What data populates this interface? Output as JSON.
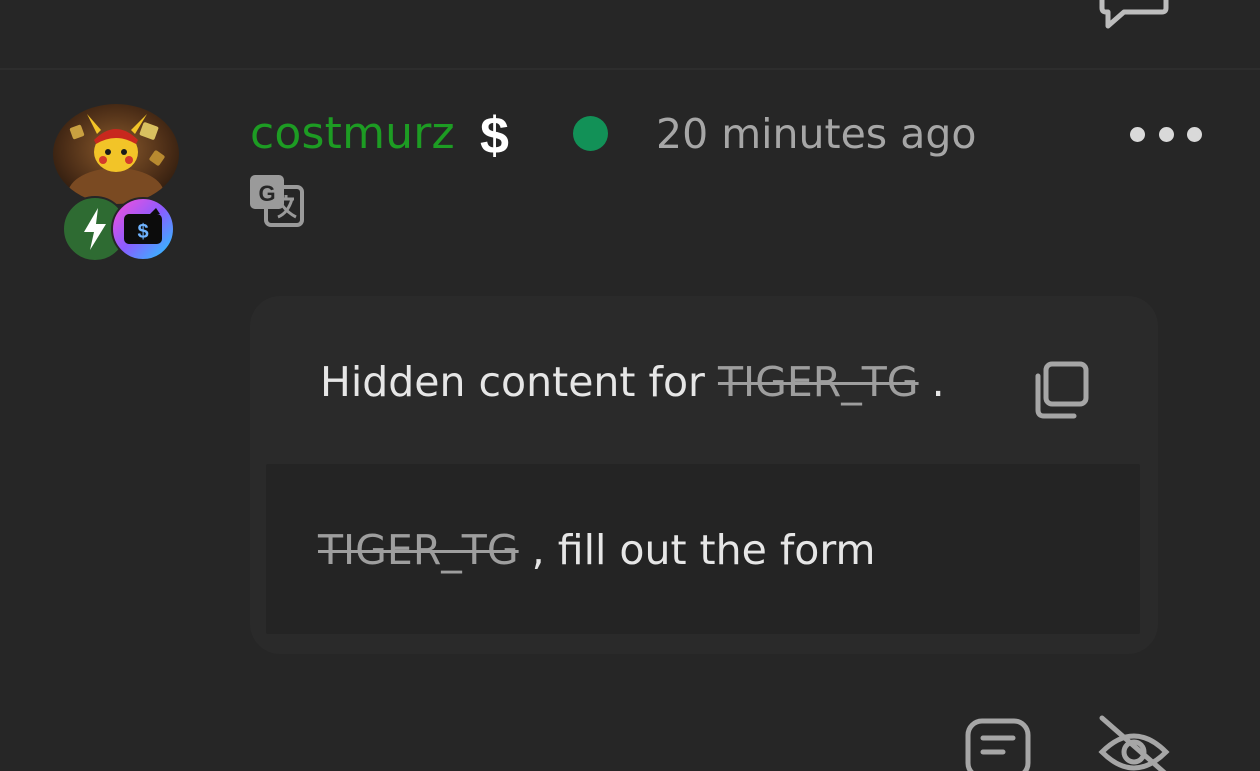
{
  "comment": {
    "username": "costmurz",
    "currency_symbol": "$",
    "timestamp": "20 minutes ago",
    "status": "online",
    "accent_colors": {
      "username": "#1d9c23",
      "online_dot": "#129157",
      "badge_bolt": "#2e6b32"
    },
    "badges": [
      "bolt-badge-icon",
      "wallet-badge-icon"
    ],
    "hidden_content": {
      "header_prefix": "Hidden content for",
      "header_user": "TIGER_TG",
      "header_suffix": ".",
      "body_user": "TIGER_TG",
      "body_text": ", fill out the form"
    }
  },
  "icons": {
    "top": "comment-icon",
    "translate": "translate-icon",
    "copy": "copy-icon",
    "reply": "reply-icon",
    "hide": "eye-off-icon",
    "more": "more-icon"
  }
}
